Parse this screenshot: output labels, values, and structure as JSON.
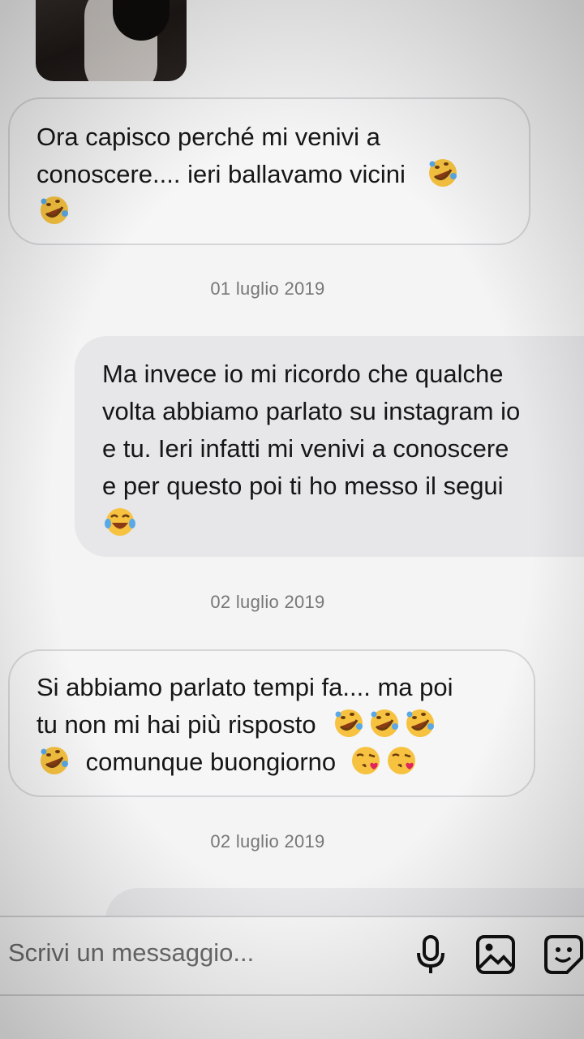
{
  "messages": [
    {
      "side": "received",
      "text": "Ora capisco perché mi venivi a conoscere.... ieri ballavamo vicini",
      "emojis": [
        "rofl",
        "rofl"
      ]
    },
    {
      "date": "01 luglio 2019"
    },
    {
      "side": "sent",
      "text": "Ma invece io mi ricordo che qualche volta abbiamo parlato su instagram io e tu. Ieri infatti mi venivi a conoscere e per questo poi ti ho messo il segui",
      "emojis": [
        "joy"
      ]
    },
    {
      "date": "02 luglio 2019"
    },
    {
      "side": "received",
      "text": "Si abbiamo parlato tempi fa.... ma poi tu non mi hai più risposto",
      "emojis": [
        "rofl",
        "rofl",
        "rofl",
        "rofl"
      ],
      "text2": "comunque buongiorno",
      "emojis2": [
        "kiss",
        "kiss"
      ]
    },
    {
      "date": "02 luglio 2019"
    }
  ],
  "m1": {
    "line1": "Ora capisco perché mi venivi a",
    "line2": "conoscere.... ieri ballavamo vicini"
  },
  "m2": {
    "line1": "Ma invece io mi ricordo che qualche",
    "line2": "volta abbiamo parlato su instagram io",
    "line3": "e tu. Ieri infatti mi venivi a conoscere",
    "line4": "e per questo poi ti ho messo il segui"
  },
  "m3": {
    "line1": "Si abbiamo parlato tempi fa.... ma poi",
    "line2": "tu non  mi hai più risposto",
    "line3": "comunque buongiorno"
  },
  "dates": {
    "d1": "01 luglio 2019",
    "d2": "02 luglio 2019",
    "d3": "02 luglio 2019"
  },
  "composer": {
    "placeholder": "Scrivi un messaggio...",
    "icons": [
      "microphone-icon",
      "gallery-icon",
      "sticker-icon"
    ]
  }
}
